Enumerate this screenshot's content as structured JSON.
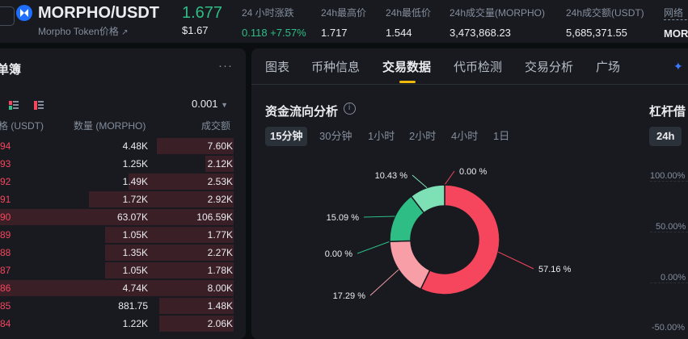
{
  "header": {
    "pair": "MORPHO/USDT",
    "token_name": "Morpho Token价格",
    "token_link_icon": "external-link-icon",
    "last_price": "1.677",
    "last_price_usd": "$1.67",
    "stats": [
      {
        "label": "24 小时涨跌",
        "value": "0.118 +7.57%",
        "up": true
      },
      {
        "label": "24h最高价",
        "value": "1.717"
      },
      {
        "label": "24h最低价",
        "value": "1.544"
      },
      {
        "label": "24h成交量(MORPHO)",
        "value": "3,473,868.23"
      },
      {
        "label": "24h成交额(USDT)",
        "value": "5,685,371.55"
      },
      {
        "label": "网络",
        "value": "MORP"
      }
    ]
  },
  "orderbook": {
    "title": "单簿",
    "more": "···",
    "precision": "0.001",
    "columns": {
      "price": "格 (USDT)",
      "qty": "数量 (MORPHO)",
      "total": "成交额"
    },
    "rows": [
      {
        "price": "94",
        "qty": "4.48K",
        "total": "7.60K",
        "depth": 0.33
      },
      {
        "price": "93",
        "qty": "1.25K",
        "total": "2.12K",
        "depth": 0.12
      },
      {
        "price": "92",
        "qty": "1.49K",
        "total": "2.53K",
        "depth": 0.45
      },
      {
        "price": "91",
        "qty": "1.72K",
        "total": "2.92K",
        "depth": 0.62
      },
      {
        "price": "90",
        "qty": "63.07K",
        "total": "106.59K",
        "depth": 1.0
      },
      {
        "price": "89",
        "qty": "1.05K",
        "total": "1.77K",
        "depth": 0.55
      },
      {
        "price": "88",
        "qty": "1.35K",
        "total": "2.27K",
        "depth": 0.55
      },
      {
        "price": "87",
        "qty": "1.05K",
        "total": "1.78K",
        "depth": 0.55
      },
      {
        "price": "86",
        "qty": "4.74K",
        "total": "8.00K",
        "depth": 1.0
      },
      {
        "price": "85",
        "qty": "881.75",
        "total": "1.48K",
        "depth": 0.32
      },
      {
        "price": "84",
        "qty": "1.22K",
        "total": "2.06K",
        "depth": 0.32
      }
    ]
  },
  "tabs": [
    "图表",
    "币种信息",
    "交易数据",
    "代币检测",
    "交易分析",
    "广场"
  ],
  "active_tab": "交易数据",
  "fund_flow": {
    "title": "资金流向分析",
    "intervals": [
      "15分钟",
      "30分钟",
      "1小时",
      "2小时",
      "4小时",
      "1日"
    ],
    "active_interval": "15分钟"
  },
  "leverage": {
    "title": "杠杆借",
    "range_button": "24h",
    "y_ticks": [
      "100.00%",
      "50.00%",
      "0.00%",
      "-50.00%"
    ]
  },
  "chart_data": {
    "type": "pie",
    "title": "资金流向分析",
    "hole": true,
    "slices": [
      {
        "label": "0.00 %",
        "value": 0.0,
        "color": "#f6465d"
      },
      {
        "label": "57.16 %",
        "value": 57.16,
        "color": "#f6465d"
      },
      {
        "label": "17.29 %",
        "value": 17.29,
        "color": "#f79ea6"
      },
      {
        "label": "0.00 %",
        "value": 0.0,
        "color": "#2ebd85"
      },
      {
        "label": "15.09 %",
        "value": 15.09,
        "color": "#2ebd85"
      },
      {
        "label": "10.43 %",
        "value": 10.43,
        "color": "#7ee0b5"
      }
    ]
  }
}
